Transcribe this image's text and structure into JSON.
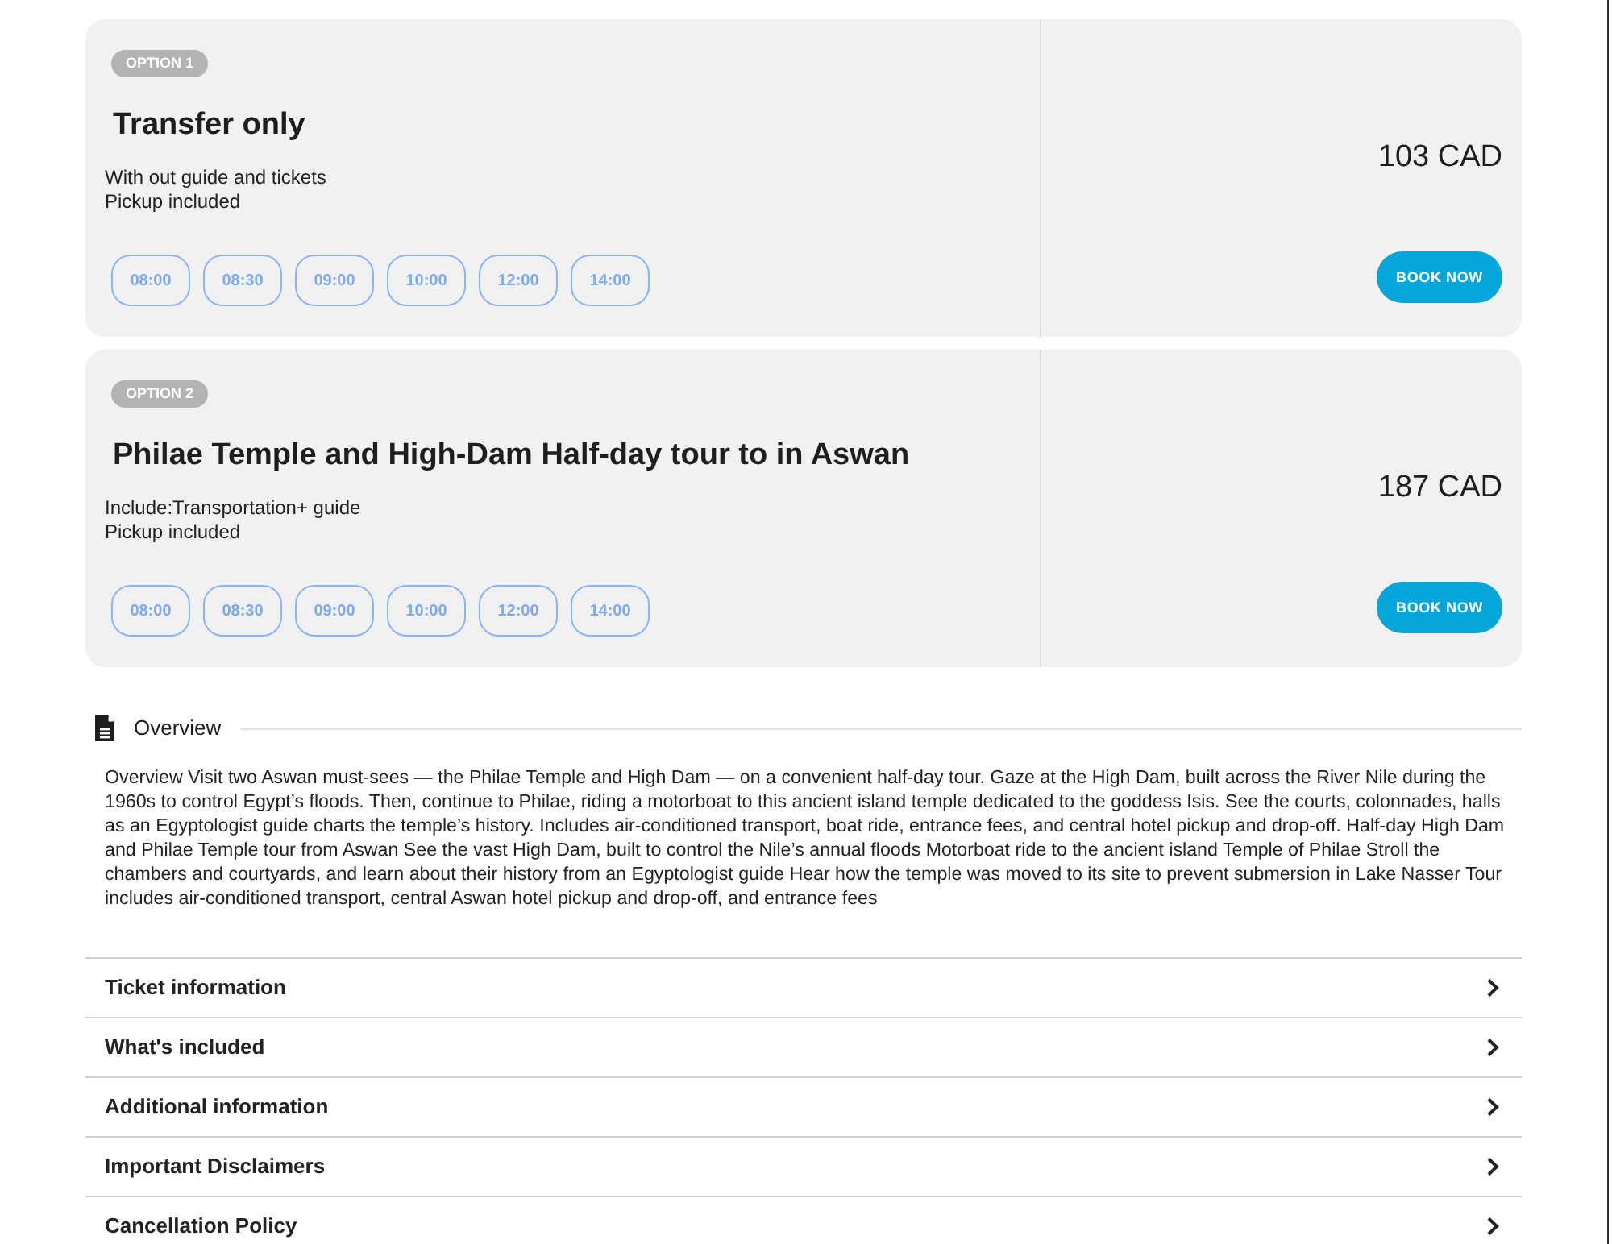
{
  "options": [
    {
      "badge": "OPTION 1",
      "title": "Transfer only",
      "details": [
        "With out guide and tickets",
        "Pickup included"
      ],
      "times": [
        {
          "label": "08:00",
          "selected": false
        },
        {
          "label": "08:30",
          "selected": false
        },
        {
          "label": "09:00",
          "selected": false
        },
        {
          "label": "10:00",
          "selected": false
        },
        {
          "label": "12:00",
          "selected": false
        },
        {
          "label": "14:00",
          "selected": false
        }
      ],
      "price": "103 CAD",
      "button": "BOOK NOW"
    },
    {
      "badge": "OPTION 2",
      "title": "Philae Temple and High-Dam Half-day tour to in Aswan",
      "details": [
        "Include:Transportation+ guide",
        "Pickup included"
      ],
      "times": [
        {
          "label": "08:00",
          "selected": false
        },
        {
          "label": "08:30",
          "selected": false
        },
        {
          "label": "09:00",
          "selected": false
        },
        {
          "label": "10:00",
          "selected": false
        },
        {
          "label": "12:00",
          "selected": false
        },
        {
          "label": "14:00",
          "selected": false
        }
      ],
      "price": "187 CAD",
      "button": "BOOK NOW"
    }
  ],
  "overview": {
    "heading": "Overview",
    "text": "Overview Visit two Aswan must-sees — the Philae Temple and High Dam — on a convenient half-day tour. Gaze at the High Dam, built across the River Nile during the 1960s to control Egypt’s floods. Then, continue to Philae, riding a motorboat to this ancient island temple dedicated to the goddess Isis. See the courts, colonnades, halls as an Egyptologist guide charts the temple’s history. Includes air-conditioned transport, boat ride, entrance fees, and central hotel pickup and drop-off. Half-day High Dam and Philae Temple tour from Aswan See the vast High Dam, built to control the Nile’s annual floods Motorboat ride to the ancient island Temple of Philae Stroll the chambers and courtyards, and learn about their history from an Egyptologist guide Hear how the temple was moved to its site to prevent submersion in Lake Nasser Tour includes air-conditioned transport, central Aswan hotel pickup and drop-off, and entrance fees"
  },
  "accordion": [
    {
      "label": "Ticket information",
      "expanded": false
    },
    {
      "label": "What's included",
      "expanded": false
    },
    {
      "label": "Additional information",
      "expanded": false
    },
    {
      "label": "Important Disclaimers",
      "expanded": false
    },
    {
      "label": "Cancellation Policy",
      "expanded": false
    }
  ]
}
